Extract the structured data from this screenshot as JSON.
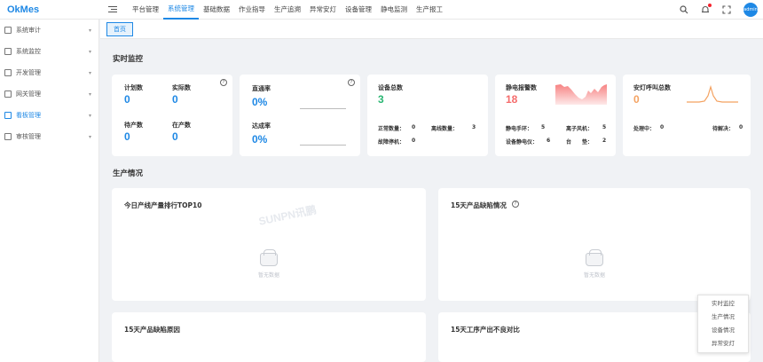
{
  "app": {
    "logo": "OkMes"
  },
  "nav": [
    {
      "label": "平台管理"
    },
    {
      "label": "系统管理"
    },
    {
      "label": "基础数据"
    },
    {
      "label": "作业指导"
    },
    {
      "label": "生产追溯"
    },
    {
      "label": "异常安灯"
    },
    {
      "label": "设备管理"
    },
    {
      "label": "静电监测"
    },
    {
      "label": "生产报工"
    }
  ],
  "header": {
    "avatar_text": "admin"
  },
  "sidebar": [
    {
      "label": "系统审计"
    },
    {
      "label": "系统监控"
    },
    {
      "label": "开发管理"
    },
    {
      "label": "网关管理"
    },
    {
      "label": "看板管理"
    },
    {
      "label": "审核管理"
    }
  ],
  "tabs": [
    {
      "label": "首页"
    }
  ],
  "realtime": {
    "title": "实时监控",
    "plan": {
      "planned_label": "计划数",
      "planned_value": "0",
      "actual_label": "实际数",
      "actual_value": "0",
      "pending_label": "待产数",
      "pending_value": "0",
      "inprod_label": "在产数",
      "inprod_value": "0"
    },
    "rate": {
      "pass_label": "直通率",
      "pass_value": "0%",
      "reach_label": "达成率",
      "reach_value": "0%"
    },
    "equipment": {
      "title": "设备总数",
      "value": "3",
      "normal_label": "正常数量：",
      "normal_value": "0",
      "offline_label": "离线数量：",
      "offline_value": "3",
      "fault_label": "故障停机：",
      "fault_value": "0"
    },
    "esd": {
      "title": "静电报警数",
      "value": "18",
      "wrist_label": "静电手环：",
      "wrist_value": "5",
      "ion_label": "离子风机：",
      "ion_value": "5",
      "device_label": "设备静电仪：",
      "device_value": "6",
      "mat_label": "台　　垫：",
      "mat_value": "2"
    },
    "andon": {
      "title": "安灯呼叫总数",
      "value": "0",
      "handling_label": "处理中：",
      "handling_value": "0",
      "pending_label": "待解决：",
      "pending_value": "0"
    }
  },
  "production": {
    "title": "生产情况",
    "panels": [
      {
        "title": "今日产线产量排行TOP10"
      },
      {
        "title": "15天产品缺陷情况"
      },
      {
        "title": "15天产品缺陷原因"
      },
      {
        "title": "15天工序产出不良对比"
      }
    ],
    "empty_text": "暂无数据"
  },
  "watermark": "SUNPN讯鹏",
  "float_menu": [
    {
      "label": "实时监控"
    },
    {
      "label": "生产情况"
    },
    {
      "label": "设备情况"
    },
    {
      "label": "异常安灯"
    }
  ],
  "colors": {
    "accent": "#1e88e5",
    "green": "#2bb673",
    "red": "#f56c6c",
    "orange": "#f4a261"
  }
}
